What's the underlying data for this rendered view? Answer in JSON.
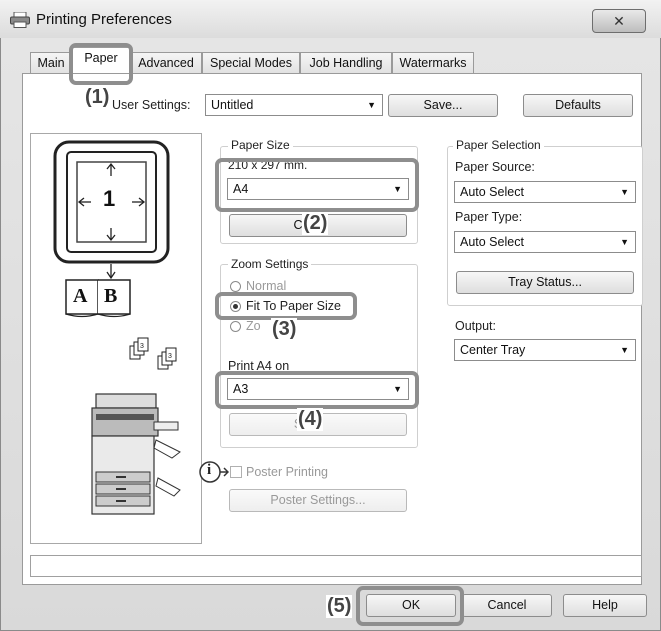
{
  "window": {
    "title": "Printing Preferences",
    "close_glyph": "✕"
  },
  "tabs": [
    {
      "label": "Main"
    },
    {
      "label": "Paper"
    },
    {
      "label": "Advanced"
    },
    {
      "label": "Special Modes"
    },
    {
      "label": "Job Handling"
    },
    {
      "label": "Watermarks"
    }
  ],
  "user_settings": {
    "label": "User Settings:",
    "value": "Untitled",
    "save_label": "Save...",
    "defaults_label": "Defaults"
  },
  "preview": {
    "page_number": "1",
    "book_left": "A",
    "book_right": "B",
    "doc_icons": "📄"
  },
  "paper_size": {
    "title": "Paper Size",
    "dimensions": "210 x 297 mm.",
    "value": "A4",
    "custom_button_partial": "C"
  },
  "zoom_settings": {
    "title": "Zoom Settings",
    "normal_label": "Normal",
    "fit_label": "Fit To Paper Size",
    "zoom_label_partial": "Zo"
  },
  "print_on": {
    "label": "Print A4 on",
    "value": "A3",
    "settings_button_partial": "S"
  },
  "poster": {
    "checkbox_label": "Poster Printing",
    "settings_button": "Poster Settings..."
  },
  "paper_selection": {
    "title": "Paper Selection",
    "source_label": "Paper Source:",
    "source_value": "Auto Select",
    "type_label": "Paper Type:",
    "type_value": "Auto Select",
    "tray_status_button": "Tray Status..."
  },
  "output": {
    "label": "Output:",
    "value": "Center Tray"
  },
  "buttons": {
    "ok": "OK",
    "cancel": "Cancel",
    "help": "Help"
  },
  "callouts": [
    "(1)",
    "(2)",
    "(3)",
    "(4)",
    "(5)"
  ],
  "dropdown_glyph": "▼",
  "info_glyph": "i",
  "colors": {
    "callout_border": "#8e8e8e",
    "callout_text": "#444444",
    "window_bg": "#dcdcdc"
  }
}
